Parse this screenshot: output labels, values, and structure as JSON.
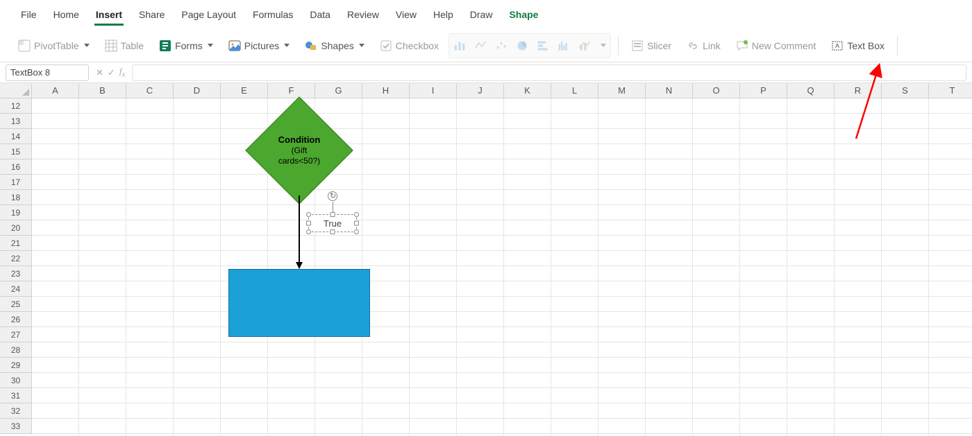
{
  "menu": {
    "tabs": [
      "File",
      "Home",
      "Insert",
      "Share",
      "Page Layout",
      "Formulas",
      "Data",
      "Review",
      "View",
      "Help",
      "Draw",
      "Shape"
    ],
    "active": "Insert",
    "context_tab": "Shape"
  },
  "ribbon": {
    "pivot": "PivotTable",
    "table": "Table",
    "forms": "Forms",
    "pictures": "Pictures",
    "shapes": "Shapes",
    "checkbox": "Checkbox",
    "slicer": "Slicer",
    "link": "Link",
    "new_comment": "New Comment",
    "text_box": "Text Box"
  },
  "namebox": {
    "value": "TextBox 8"
  },
  "formula_bar": {
    "value": ""
  },
  "columns": [
    "A",
    "B",
    "C",
    "D",
    "E",
    "F",
    "G",
    "H",
    "I",
    "J",
    "K",
    "L",
    "M",
    "N",
    "O",
    "P",
    "Q",
    "R",
    "S",
    "T"
  ],
  "rows": [
    12,
    13,
    14,
    15,
    16,
    17,
    18,
    19,
    20,
    21,
    22,
    23,
    24,
    25,
    26,
    27,
    28,
    29,
    30,
    31,
    32,
    33
  ],
  "shapes": {
    "diamond": {
      "title": "Condition",
      "line1": "(Gift",
      "line2": "cards<50?)"
    },
    "textbox": {
      "text": "True"
    }
  },
  "colors": {
    "accent_green": "#107c41",
    "shape_green": "#4ca72e",
    "shape_blue": "#1ba1d6",
    "annotation_red": "#ff0000"
  }
}
